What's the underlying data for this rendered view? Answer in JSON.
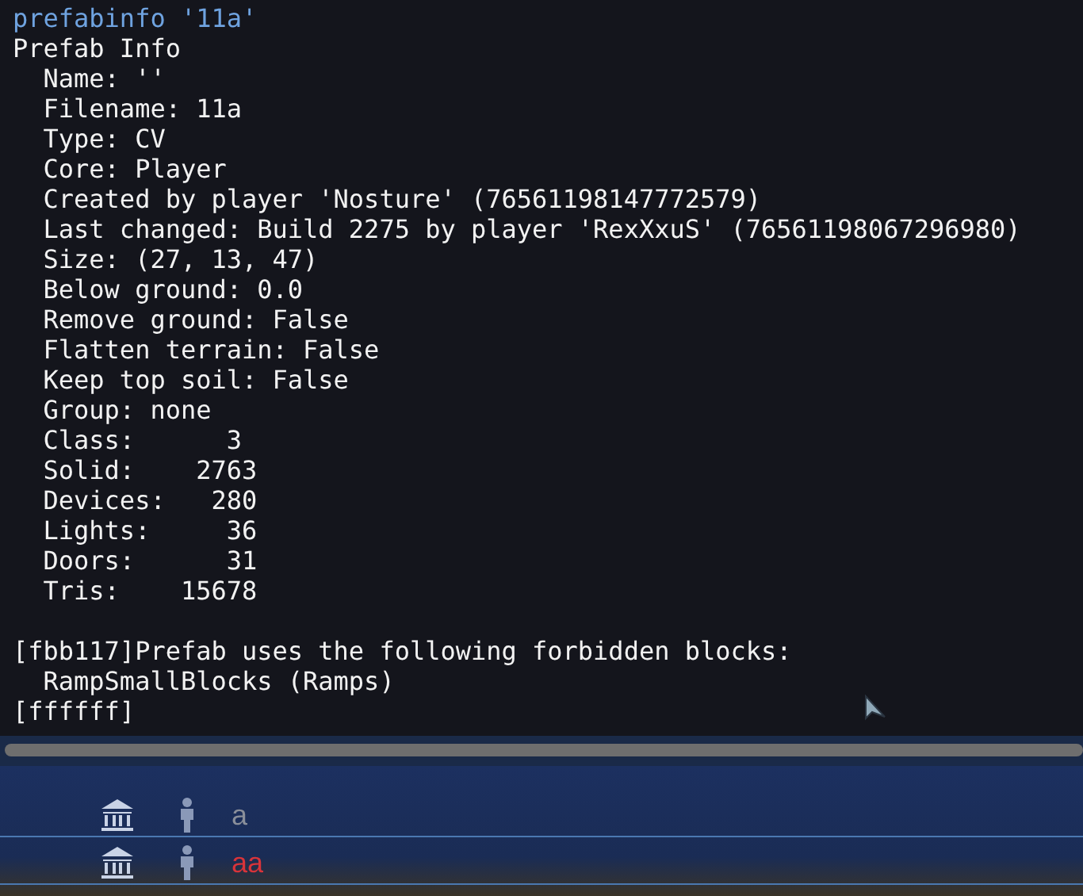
{
  "console": {
    "lines": [
      {
        "kind": "command",
        "text": "prefabinfo '11a'"
      },
      {
        "kind": "output",
        "text": "Prefab Info"
      },
      {
        "kind": "output",
        "text": "  Name: ''"
      },
      {
        "kind": "output",
        "text": "  Filename: 11a"
      },
      {
        "kind": "output",
        "text": "  Type: CV"
      },
      {
        "kind": "output",
        "text": "  Core: Player"
      },
      {
        "kind": "output",
        "text": "  Created by player 'Nosture' (76561198147772579)"
      },
      {
        "kind": "output",
        "text": "  Last changed: Build 2275 by player 'RexXxuS' (76561198067296980)"
      },
      {
        "kind": "output",
        "text": "  Size: (27, 13, 47)"
      },
      {
        "kind": "output",
        "text": "  Below ground: 0.0"
      },
      {
        "kind": "output",
        "text": "  Remove ground: False"
      },
      {
        "kind": "output",
        "text": "  Flatten terrain: False"
      },
      {
        "kind": "output",
        "text": "  Keep top soil: False"
      },
      {
        "kind": "output",
        "text": "  Group: none"
      },
      {
        "kind": "output",
        "text": "  Class:      3"
      },
      {
        "kind": "output",
        "text": "  Solid:    2763"
      },
      {
        "kind": "output",
        "text": "  Devices:   280"
      },
      {
        "kind": "output",
        "text": "  Lights:     36"
      },
      {
        "kind": "output",
        "text": "  Doors:      31"
      },
      {
        "kind": "output",
        "text": "  Tris:    15678"
      },
      {
        "kind": "blank"
      },
      {
        "kind": "output",
        "text": "[fbb117]Prefab uses the following forbidden blocks:"
      },
      {
        "kind": "output",
        "text": "  RampSmallBlocks (Ramps)"
      },
      {
        "kind": "output",
        "text": "[ffffff]"
      }
    ]
  },
  "background_list": {
    "rows": [
      {
        "name": "a",
        "color": "#8a8f9a"
      },
      {
        "name": "aa",
        "color": "#d8343a"
      }
    ]
  }
}
